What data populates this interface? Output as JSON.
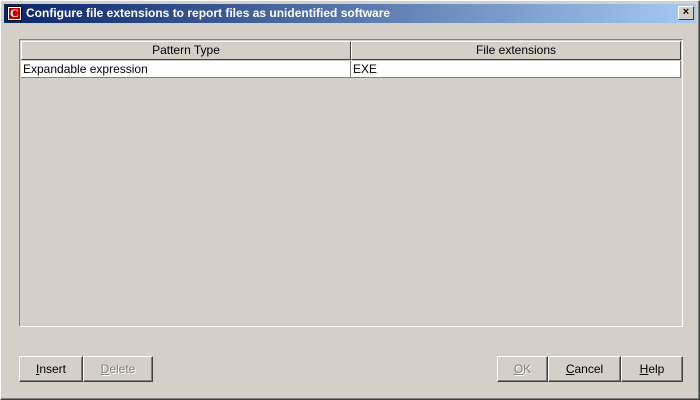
{
  "window": {
    "title": "Configure file extensions to report files as unidentified software",
    "close_glyph": "×",
    "icon_letter": "C"
  },
  "table": {
    "columns": [
      "Pattern Type",
      "File extensions"
    ],
    "rows": [
      {
        "pattern_type": "Expandable expression",
        "file_extensions": "EXE"
      }
    ]
  },
  "buttons": {
    "insert": {
      "mnemonic": "I",
      "rest": "nsert",
      "enabled": true
    },
    "delete": {
      "mnemonic": "D",
      "rest": "elete",
      "enabled": false
    },
    "ok": {
      "mnemonic": "O",
      "rest": "K",
      "enabled": false
    },
    "cancel": {
      "mnemonic": "C",
      "rest": "ancel",
      "enabled": true
    },
    "help": {
      "mnemonic": "H",
      "rest": "elp",
      "enabled": true
    }
  }
}
